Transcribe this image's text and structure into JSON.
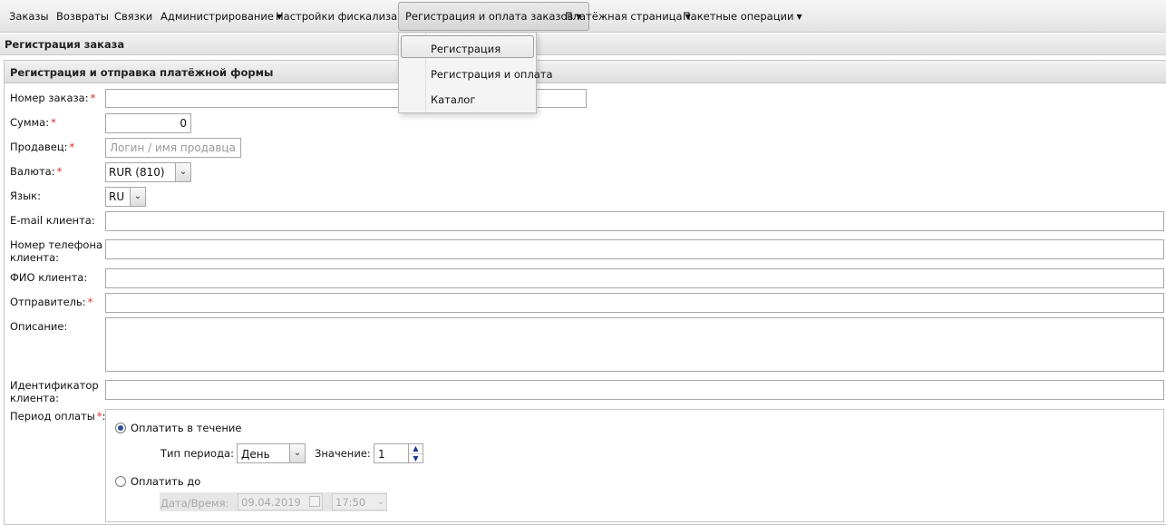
{
  "topnav": {
    "items": [
      {
        "label": "Заказы"
      },
      {
        "label": "Возвраты"
      },
      {
        "label": "Связки"
      },
      {
        "label": "Администрирование"
      },
      {
        "label": "Настройки фискализации"
      },
      {
        "label": "Регистрация и оплата заказов"
      },
      {
        "label": "Платёжная страница"
      },
      {
        "label": "Пакетные операции"
      }
    ],
    "dropdown": [
      "Регистрация",
      "Регистрация и оплата",
      "Каталог"
    ]
  },
  "page": {
    "title": "Регистрация заказа",
    "panel_title": "Регистрация и отправка платёжной формы"
  },
  "form": {
    "order_number_label": "Номер заказа:",
    "amount_label": "Сумма:",
    "amount_value": "0",
    "seller_label": "Продавец:",
    "seller_placeholder": "Логин / имя продавца",
    "currency_label": "Валюта:",
    "currency_value": "RUR (810)",
    "language_label": "Язык:",
    "language_value": "RU",
    "email_label": "E-mail клиента:",
    "phone_label_1": "Номер телефона",
    "phone_label_2": "клиента:",
    "fio_label": "ФИО клиента:",
    "sender_label": "Отправитель:",
    "description_label": "Описание:",
    "client_id_label_1": "Идентификатор",
    "client_id_label_2": "клиента:",
    "period_label": "Период оплаты",
    "pay_within_label": "Оплатить в течение",
    "period_type_label": "Тип периода:",
    "period_type_value": "День",
    "value_label": "Значение:",
    "value_value": "1",
    "pay_until_label": "Оплатить до",
    "datetime_label": "Дата/Время:",
    "date_value": "09.04.2019",
    "time_value": "17:50",
    "required_mark": "*"
  },
  "colors": {
    "required": "#e02a2a",
    "radio_checked": "#2a4f9a"
  }
}
